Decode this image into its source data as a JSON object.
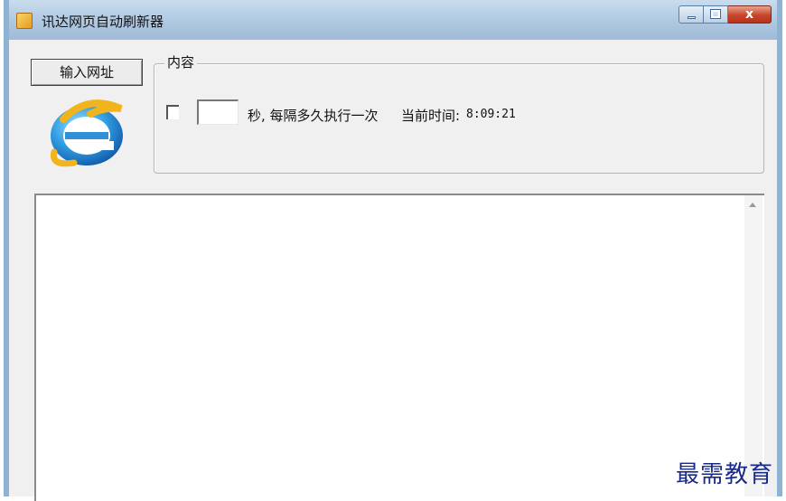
{
  "window": {
    "title": "讯达网页自动刷新器",
    "controls": {
      "minimize_icon": "minimize-icon",
      "maximize_icon": "maximize-icon",
      "close_label": "x"
    }
  },
  "toolbar": {
    "url_button_label": "输入网址",
    "logo_icon": "internet-explorer-icon"
  },
  "content_group": {
    "legend": "内容",
    "seconds_value": "",
    "interval_label": "秒, 每隔多久执行一次",
    "time_label": "当前时间:",
    "time_value": "8:09:21"
  },
  "watermark": "最需教育",
  "colors": {
    "titlebar": "#b3cbe3",
    "close_button": "#c7462a",
    "watermark": "#1a2a8a"
  }
}
